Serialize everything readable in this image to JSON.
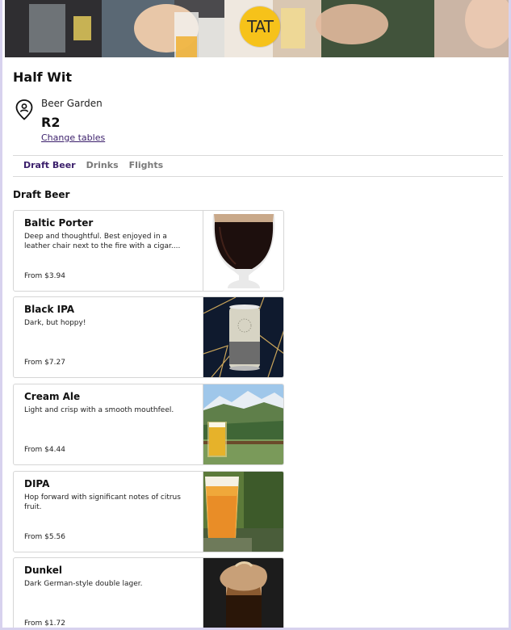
{
  "header": {
    "logo_text": "TAT"
  },
  "venue": {
    "title": "Half Wit",
    "area": "Beer Garden",
    "table": "R2",
    "change_link": "Change tables"
  },
  "tabs": [
    {
      "label": "Draft Beer",
      "active": true
    },
    {
      "label": "Drinks",
      "active": false
    },
    {
      "label": "Flights",
      "active": false
    }
  ],
  "section": {
    "title": "Draft Beer"
  },
  "items": [
    {
      "name": "Baltic Porter",
      "description": "Deep and thoughtful. Best enjoyed in a leather chair next to the fire with a cigar....",
      "price": "From $3.94"
    },
    {
      "name": "Black IPA",
      "description": "Dark, but hoppy!",
      "price": "From $7.27"
    },
    {
      "name": "Cream Ale",
      "description": "Light and crisp with a smooth mouthfeel.",
      "price": "From $4.44"
    },
    {
      "name": "DIPA",
      "description": "Hop forward with significant notes of citrus fruit.",
      "price": "From $5.56"
    },
    {
      "name": "Dunkel",
      "description": "Dark German-style double lager.",
      "price": "From $1.72"
    }
  ],
  "colors": {
    "accent": "#3b1f6b",
    "logo": "#f6c21a",
    "border": "#d6d6d6"
  }
}
